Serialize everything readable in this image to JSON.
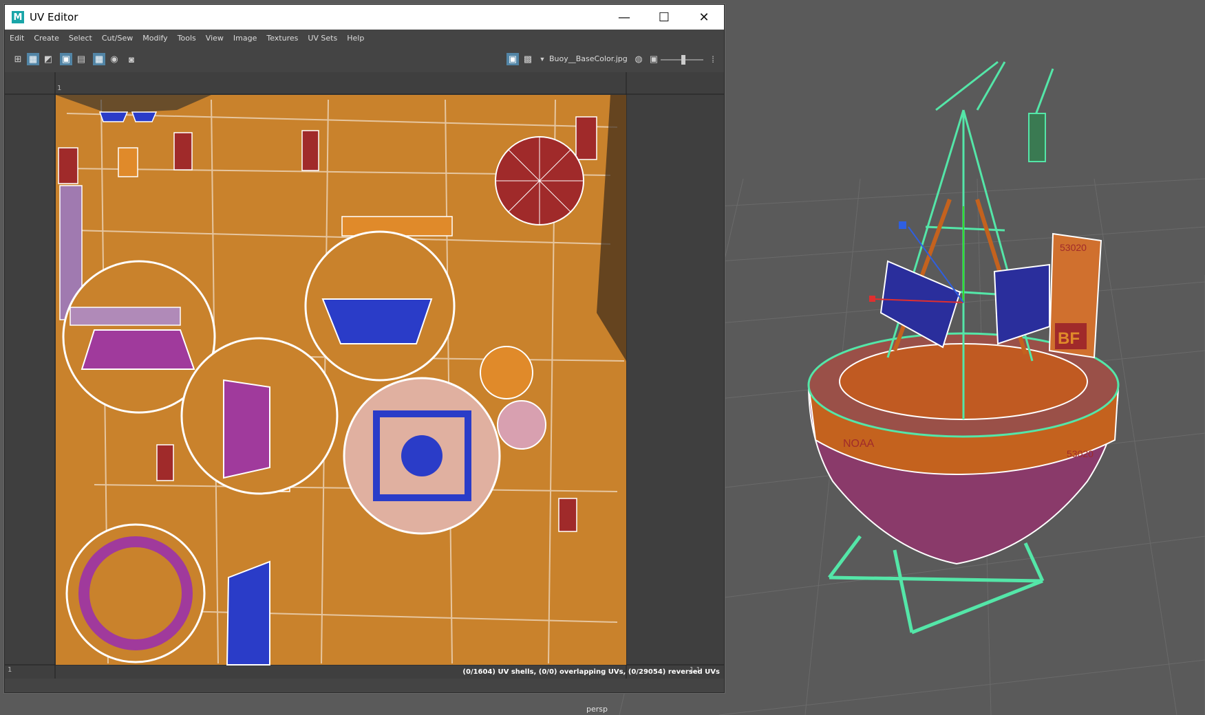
{
  "window": {
    "title": "UV Editor",
    "app_icon": "M",
    "controls": [
      "minimize-icon",
      "maximize-icon",
      "close-icon"
    ]
  },
  "menu": [
    "Edit",
    "Create",
    "Select",
    "Cut/Sew",
    "Modify",
    "Tools",
    "View",
    "Image",
    "Textures",
    "UV Sets",
    "Help"
  ],
  "toolbar": {
    "texture_name": "Buoy__BaseColor.jpg"
  },
  "uv_grid": {
    "top_left_tick": "1",
    "bottom_left_tick": "1",
    "bottom_right_tick": "1,1"
  },
  "status": "(0/1604) UV shells, (0/0) overlapping UVs, (0/29054) reversed UVs",
  "viewport": {
    "camera": "persp",
    "decal_top": "53020",
    "decal_side": "53020",
    "decal_noaa": "NOAA",
    "decal_bf": "BF"
  },
  "colors": {
    "orange": "#e08a2a",
    "maroon": "#a02a2a",
    "blue": "#2a3cc8",
    "purple": "#a03a9c",
    "wire_green": "#54e6a8"
  }
}
